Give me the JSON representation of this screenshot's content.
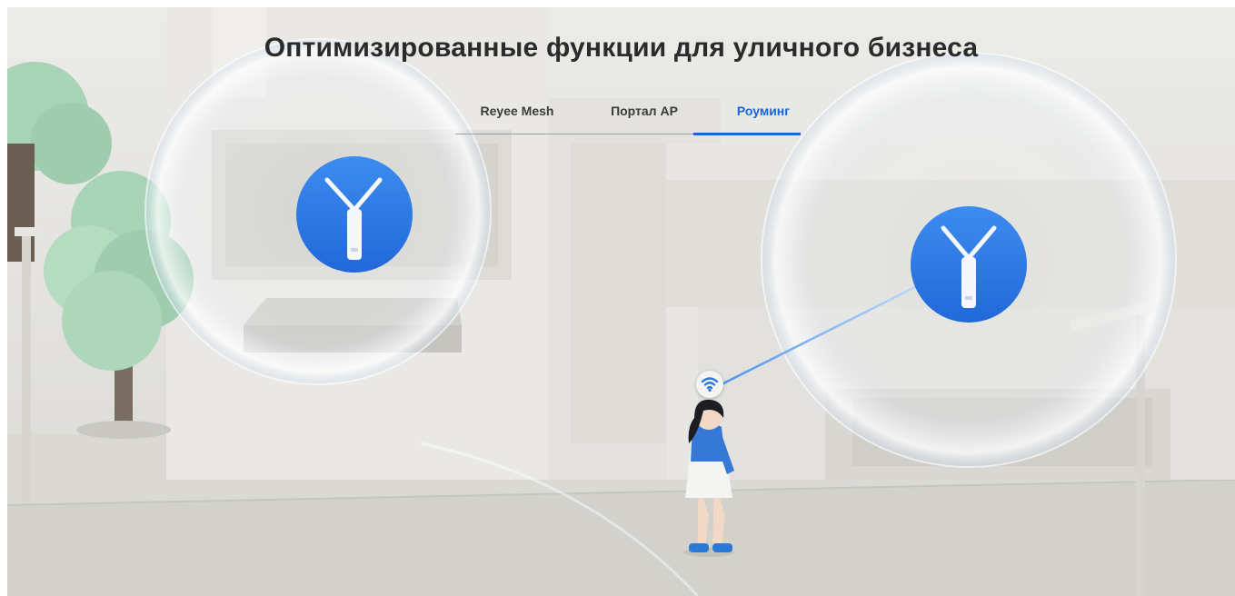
{
  "page": {
    "title": "Оптимизированные функции для уличного бизнеса"
  },
  "tabs": {
    "items": [
      {
        "label": "Reyee Mesh",
        "active": false
      },
      {
        "label": "Портал AP",
        "active": false
      },
      {
        "label": "Роуминг",
        "active": true
      }
    ]
  },
  "illustration": {
    "icons": [
      "access-point-icon",
      "wifi-icon"
    ],
    "colors": {
      "accent": "#1b64d8",
      "access_point_disc": "#2f7fe6",
      "background": "#e6e5e1"
    }
  }
}
